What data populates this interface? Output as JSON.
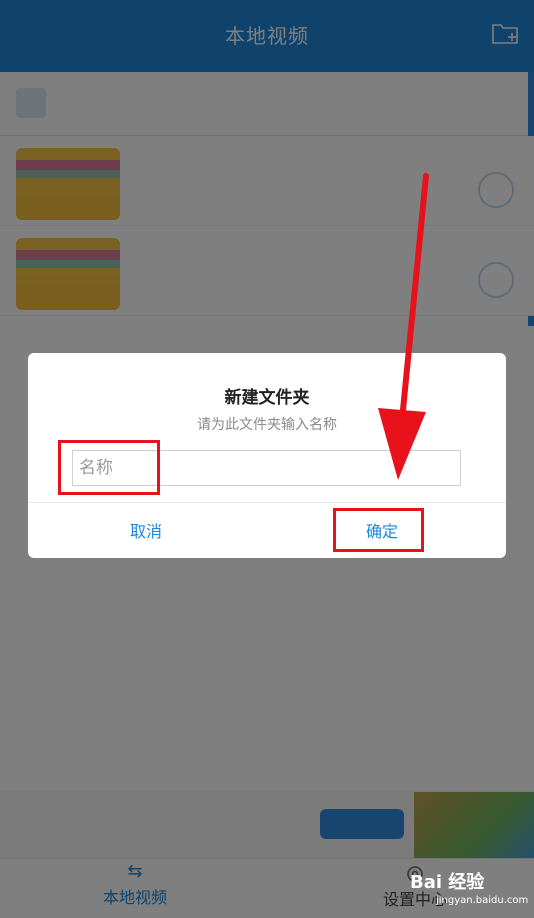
{
  "header": {
    "title": "本地视频",
    "folder_icon": "new-folder-icon"
  },
  "dialog": {
    "title": "新建文件夹",
    "subtitle": "请为此文件夹输入名称",
    "input_placeholder": "名称",
    "input_value": "",
    "cancel_label": "取消",
    "ok_label": "确定"
  },
  "bottom_nav": {
    "local_label": "本地视频",
    "settings_label": "设置中心"
  },
  "watermark": {
    "brand": "Bai 经验",
    "url": "jingyan.baidu.com"
  },
  "colors": {
    "accent": "#1f86d8",
    "annotation": "#e8121c",
    "overlay": "rgba(0,0,0,0.5)"
  }
}
